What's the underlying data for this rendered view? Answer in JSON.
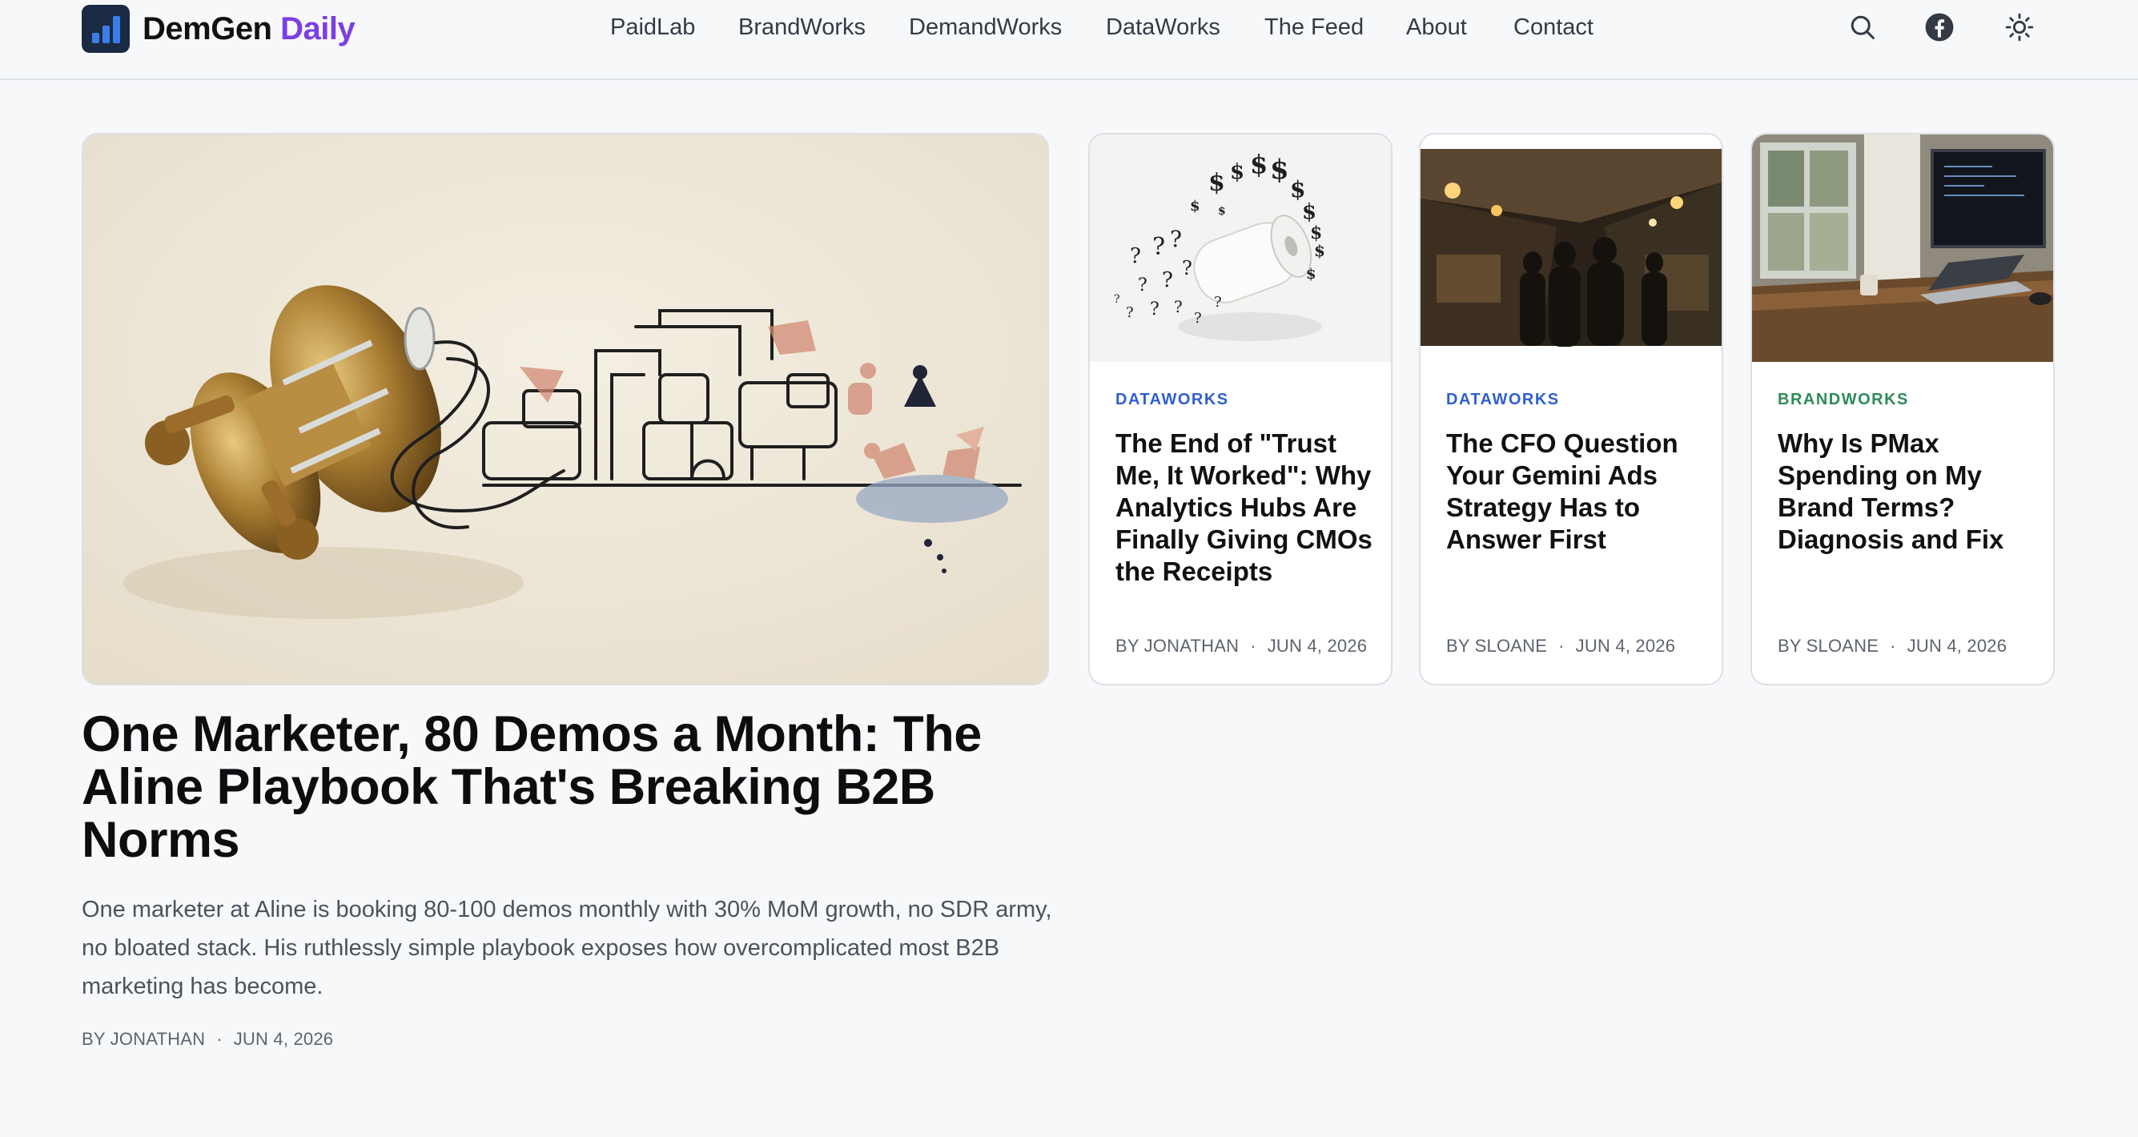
{
  "brand": {
    "name": "DemGen",
    "accent_word": "Daily"
  },
  "nav": [
    "PaidLab",
    "BrandWorks",
    "DemandWorks",
    "DataWorks",
    "The Feed",
    "About",
    "Contact"
  ],
  "header_icons": [
    "search-icon",
    "facebook-icon",
    "sun-icon"
  ],
  "hero": {
    "title": "One Marketer, 80 Demos a Month: The Aline Playbook That's Breaking B2B Norms",
    "summary": "One marketer at Aline is booking 80-100 demos monthly with 30% MoM growth, no SDR army, no bloated stack. His ruthlessly simple playbook exposes how overcomplicated most B2B marketing has become.",
    "author": "BY JONATHAN",
    "date": "JUN 4, 2026"
  },
  "cards": [
    {
      "category": "DATAWORKS",
      "title": "The End of \"Trust Me, It Worked\": Why Analytics Hubs Are Finally Giving CMOs the Receipts",
      "author": "BY JONATHAN",
      "date": "JUN 4, 2026"
    },
    {
      "category": "DATAWORKS",
      "title": "The CFO Question Your Gemini Ads Strategy Has to Answer First",
      "author": "BY SLOANE",
      "date": "JUN 4, 2026"
    },
    {
      "category": "BRANDWORKS",
      "title": "Why Is PMax Spending on My Brand Terms? Diagnosis and Fix",
      "author": "BY SLOANE",
      "date": "JUN 4, 2026"
    }
  ],
  "colors": {
    "accent": "#7b3fe4",
    "dataworks": "#2f5fd0",
    "brandworks": "#2e8b57",
    "logo_bg": "#1b2a44",
    "logo_bars": "#3b7de6"
  }
}
